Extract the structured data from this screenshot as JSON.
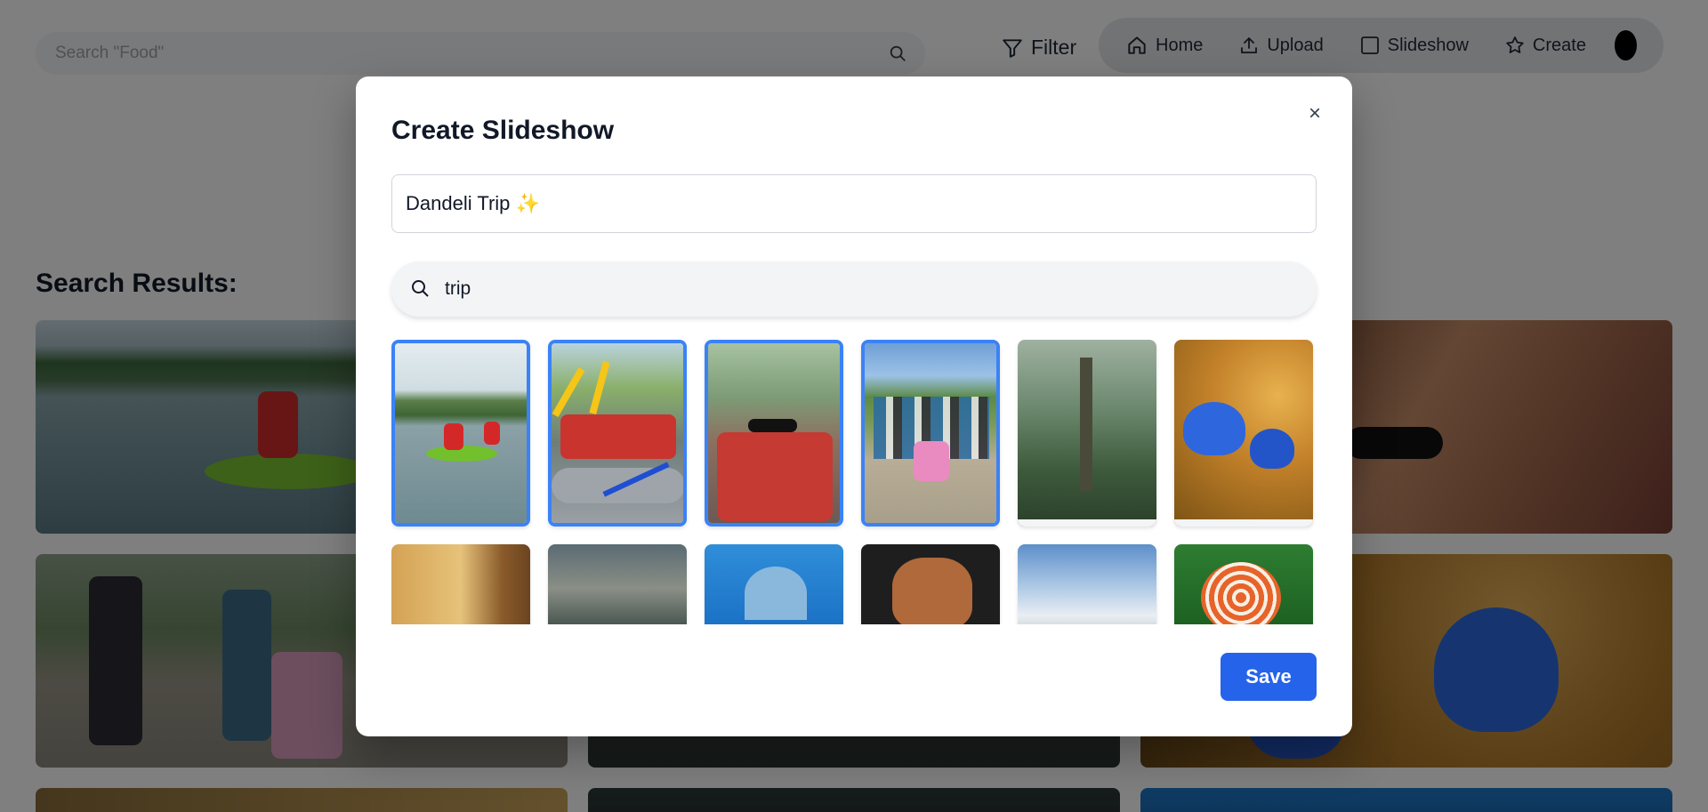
{
  "search": {
    "placeholder": "Search \"Food\""
  },
  "filter": {
    "label": "Filter"
  },
  "nav": {
    "items": [
      {
        "label": "Home",
        "icon": "home-icon"
      },
      {
        "label": "Upload",
        "icon": "upload-icon"
      },
      {
        "label": "Slideshow",
        "icon": "slideshow-icon"
      },
      {
        "label": "Create",
        "icon": "star-icon"
      }
    ]
  },
  "results": {
    "title": "Search Results:"
  },
  "modal": {
    "title": "Create Slideshow",
    "close": "×",
    "slideshow_title": "Dandeli Trip ✨",
    "photo_search_value": "trip",
    "save_label": "Save",
    "accent": "#3b82f6",
    "save_color": "#2563eb",
    "photos": [
      {
        "subject": "kayaking on river",
        "selected": true
      },
      {
        "subject": "rafting group with paddles",
        "selected": true
      },
      {
        "subject": "group selfie in life jackets",
        "selected": true
      },
      {
        "subject": "group photo on road",
        "selected": true
      },
      {
        "subject": "misty forest",
        "selected": false
      },
      {
        "subject": "blue flowers",
        "selected": false
      },
      {
        "subject": "wooden objects",
        "selected": false
      },
      {
        "subject": "lightning storm trees",
        "selected": false
      },
      {
        "subject": "dolphin",
        "selected": false
      },
      {
        "subject": "dog",
        "selected": false
      },
      {
        "subject": "sky clouds",
        "selected": false
      },
      {
        "subject": "discus fish",
        "selected": false
      }
    ]
  }
}
